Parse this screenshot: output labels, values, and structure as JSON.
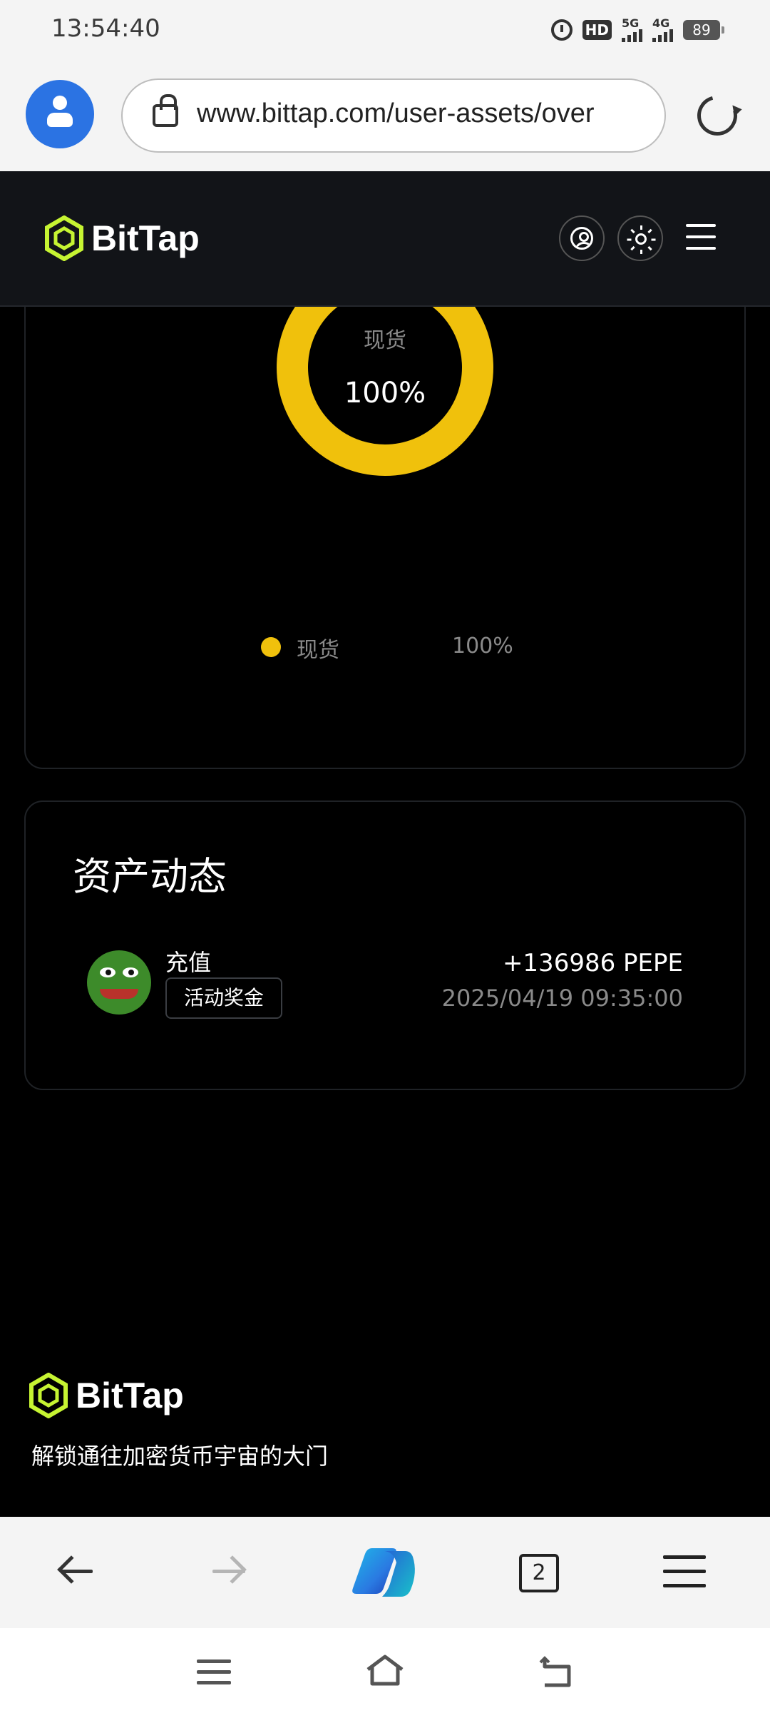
{
  "status_bar": {
    "time": "13:54:40",
    "hd_label": "HD",
    "network_5g": "5G",
    "network_4g": "4G",
    "battery": "89"
  },
  "browser": {
    "url": "www.bittap.com/user-assets/over",
    "tab_count": "2"
  },
  "site": {
    "logo_text": "BitTap",
    "brand_color": "#c6f432"
  },
  "chart_card": {
    "center_label": "现货",
    "center_value": "100%",
    "legend": [
      {
        "label": "现货",
        "value": "100%",
        "color": "#f0c10c"
      }
    ]
  },
  "chart_data": {
    "type": "pie",
    "categories": [
      "现货"
    ],
    "values": [
      100
    ],
    "colors": [
      "#f0c10c"
    ],
    "title": ""
  },
  "activity": {
    "title": "资产动态",
    "items": [
      {
        "type": "充值",
        "tag": "活动奖金",
        "amount": "+136986 PEPE",
        "time": "2025/04/19 09:35:00",
        "avatar_icon": "pepe-frog-icon"
      }
    ]
  },
  "footer": {
    "logo_text": "BitTap",
    "slogan": "解锁通往加密货币宇宙的大门"
  }
}
